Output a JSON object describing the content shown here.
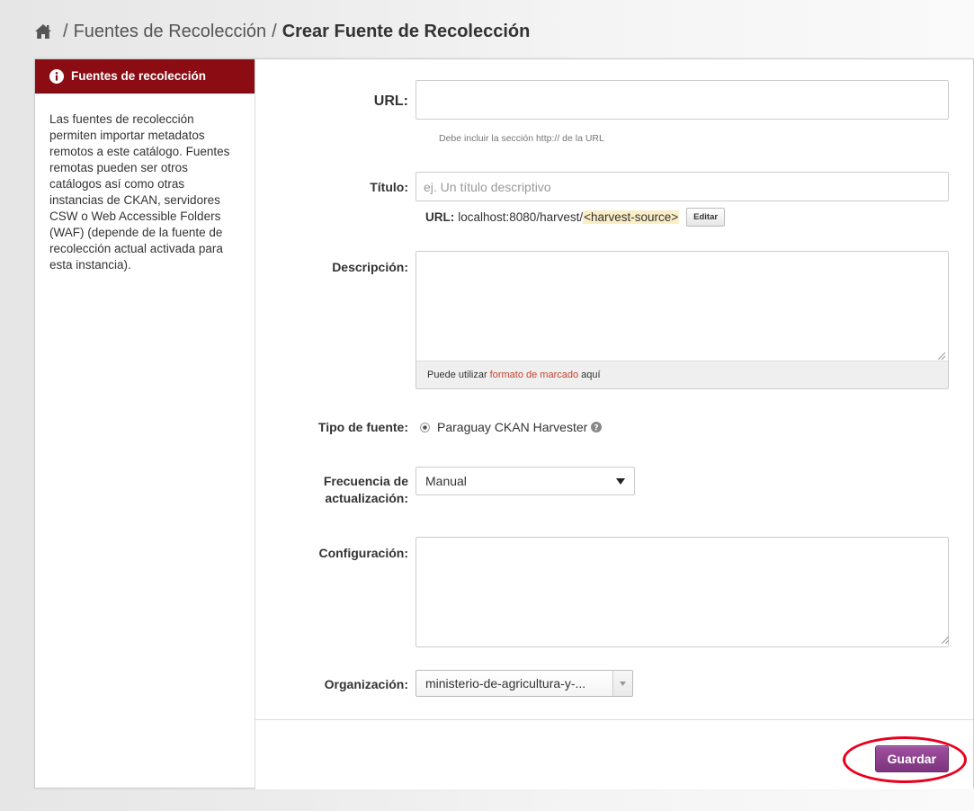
{
  "breadcrumb": {
    "home_icon": "home-icon",
    "separator": "/",
    "items": [
      {
        "label": "Fuentes de Recolección"
      },
      {
        "label": "Crear Fuente de Recolección"
      }
    ]
  },
  "sidebar": {
    "icon": "info-icon",
    "title": "Fuentes de recolección",
    "description": "Las fuentes de recolección permiten importar metadatos remotos a este catálogo. Fuentes remotas pueden ser otros catálogos así como otras instancias de CKAN, servidores CSW o Web Accessible Folders (WAF) (depende de la fuente de recolección actual activada para esta instancia)."
  },
  "form": {
    "url": {
      "label": "URL:",
      "value": "",
      "help": "Debe incluir la sección http:// de la URL"
    },
    "title": {
      "label": "Título:",
      "value": "",
      "placeholder": "ej. Un título descriptivo",
      "url_label": "URL:",
      "url_prefix": "localhost:8080/harvest/",
      "url_slug": "<harvest-source>",
      "edit_label": "Editar"
    },
    "description": {
      "label": "Descripción:",
      "value": "",
      "markdown_prefix": "Puede utilizar",
      "markdown_link": "formato de marcado",
      "markdown_suffix": "aquí"
    },
    "source_type": {
      "label": "Tipo de fuente:",
      "option": "Paraguay CKAN Harvester",
      "selected": true
    },
    "frequency": {
      "label_line1": "Frecuencia de",
      "label_line2": "actualización:",
      "value": "Manual"
    },
    "configuration": {
      "label": "Configuración:",
      "value": ""
    },
    "organization": {
      "label": "Organización:",
      "value": "ministerio-de-agricultura-y-..."
    }
  },
  "actions": {
    "save_label": "Guardar"
  },
  "colors": {
    "sidebar_header": "#8c0c13",
    "primary_button": "#8e3f8e",
    "link": "#c14531",
    "annotation_ring": "#e8001c",
    "slug_highlight": "#faeec7"
  }
}
